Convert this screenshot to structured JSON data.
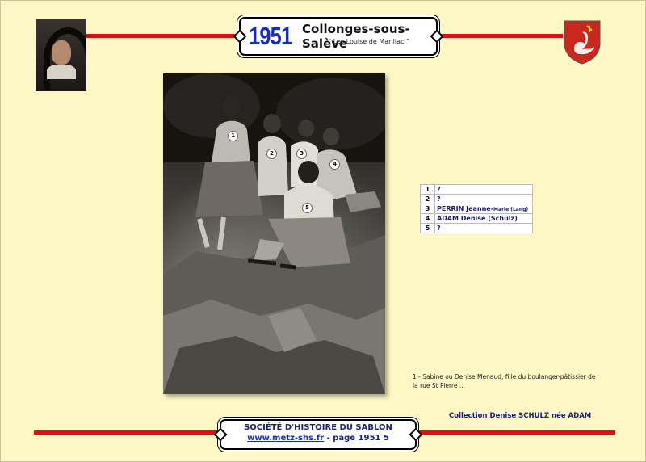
{
  "header": {
    "year": "1951",
    "title": "Collonges-sous-Salève",
    "subtitle": "“ Les Louise de Marillac ”"
  },
  "colors": {
    "background": "#fdf7c6",
    "accent_red": "#e01010",
    "year_blue": "#1a2fb0",
    "text_navy": "#1a2070"
  },
  "photo_markers": [
    "1",
    "2",
    "3",
    "4",
    "5"
  ],
  "names": [
    {
      "num": "1",
      "name": "?",
      "small": ""
    },
    {
      "num": "2",
      "name": "?",
      "small": ""
    },
    {
      "num": "3",
      "name": "PERRIN Jeanne-",
      "small": "Marie (Lang)"
    },
    {
      "num": "4",
      "name": "ADAM Denise (Schulz)",
      "small": ""
    },
    {
      "num": "5",
      "name": "?",
      "small": ""
    }
  ],
  "note": "1 - Sabine ou Denise Menaud, fille du boulanger-pâtissier de la rue St Pierre ...",
  "collection": "Collection Denise SCHULZ née ADAM",
  "footer": {
    "society": "SOCIÉTÉ D'HISTOIRE DU SABLON",
    "link": "www.metz-shs.fr",
    "page": " - page 1951 5"
  }
}
